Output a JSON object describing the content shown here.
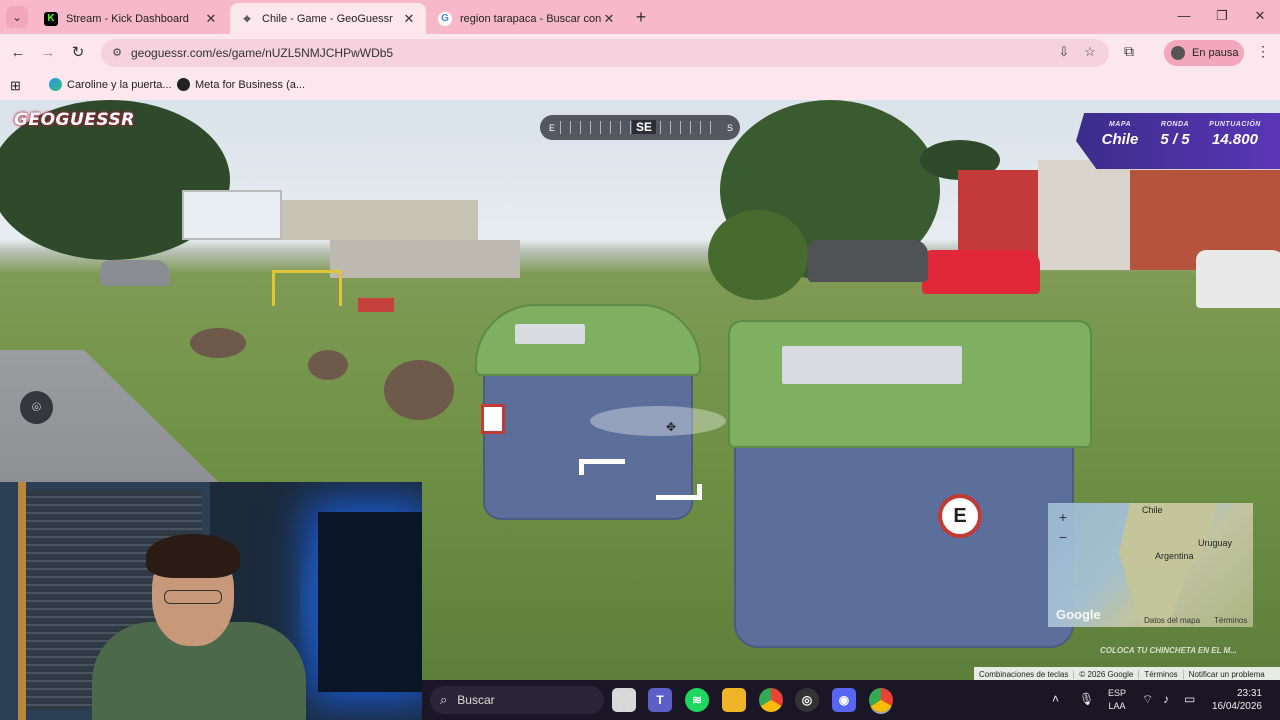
{
  "browser": {
    "tabs": [
      {
        "title": "Stream - Kick Dashboard",
        "icon": "kick-icon",
        "color": "#53fc18"
      },
      {
        "title": "Chile - Game - GeoGuessr",
        "icon": "map-pin-icon",
        "color": "#555555"
      },
      {
        "title": "region tarapaca - Buscar con Google",
        "icon": "google-icon",
        "color": "#4285f4"
      }
    ],
    "url": "geoguessr.com/es/game/nUZL5NMJCHPwWDb5",
    "profile_label": "En pausa",
    "bookmarks": [
      {
        "label": "Caroline y la puerta...",
        "icon": "edge-icon"
      },
      {
        "label": "Meta for Business (a...",
        "icon": "globe-icon"
      }
    ]
  },
  "game": {
    "logo": "GEOGUESSR",
    "compass": {
      "left": "E",
      "center": "SE",
      "right": "S"
    },
    "status": [
      {
        "label": "MAPA",
        "value": "Chile"
      },
      {
        "label": "RONDA",
        "value": "5 / 5"
      },
      {
        "label": "PUNTUACIÓN",
        "value": "14.800"
      }
    ],
    "minimap": {
      "labels": [
        "Chile",
        "Uruguay",
        "Argentina"
      ],
      "logo": "Google",
      "data_link": "Datos del mapa",
      "terms": "Términos",
      "zoom_in": "+",
      "zoom_out": "−"
    },
    "place_hint": "COLOCA TU CHINCHETA EN EL M..."
  },
  "streetview_footer": [
    "Combinaciones de teclas",
    "© 2026 Google",
    "Términos",
    "Notificar un problema"
  ],
  "taskbar": {
    "search_placeholder": "Buscar",
    "lang_top": "ESP",
    "lang_bottom": "LAA",
    "time": "23:31",
    "date": "16/04/2026"
  },
  "colors": {
    "tabbar": "#f7b8cc",
    "toolbar": "#fde7ee",
    "geoguessr_panel": "#4a33a6"
  }
}
